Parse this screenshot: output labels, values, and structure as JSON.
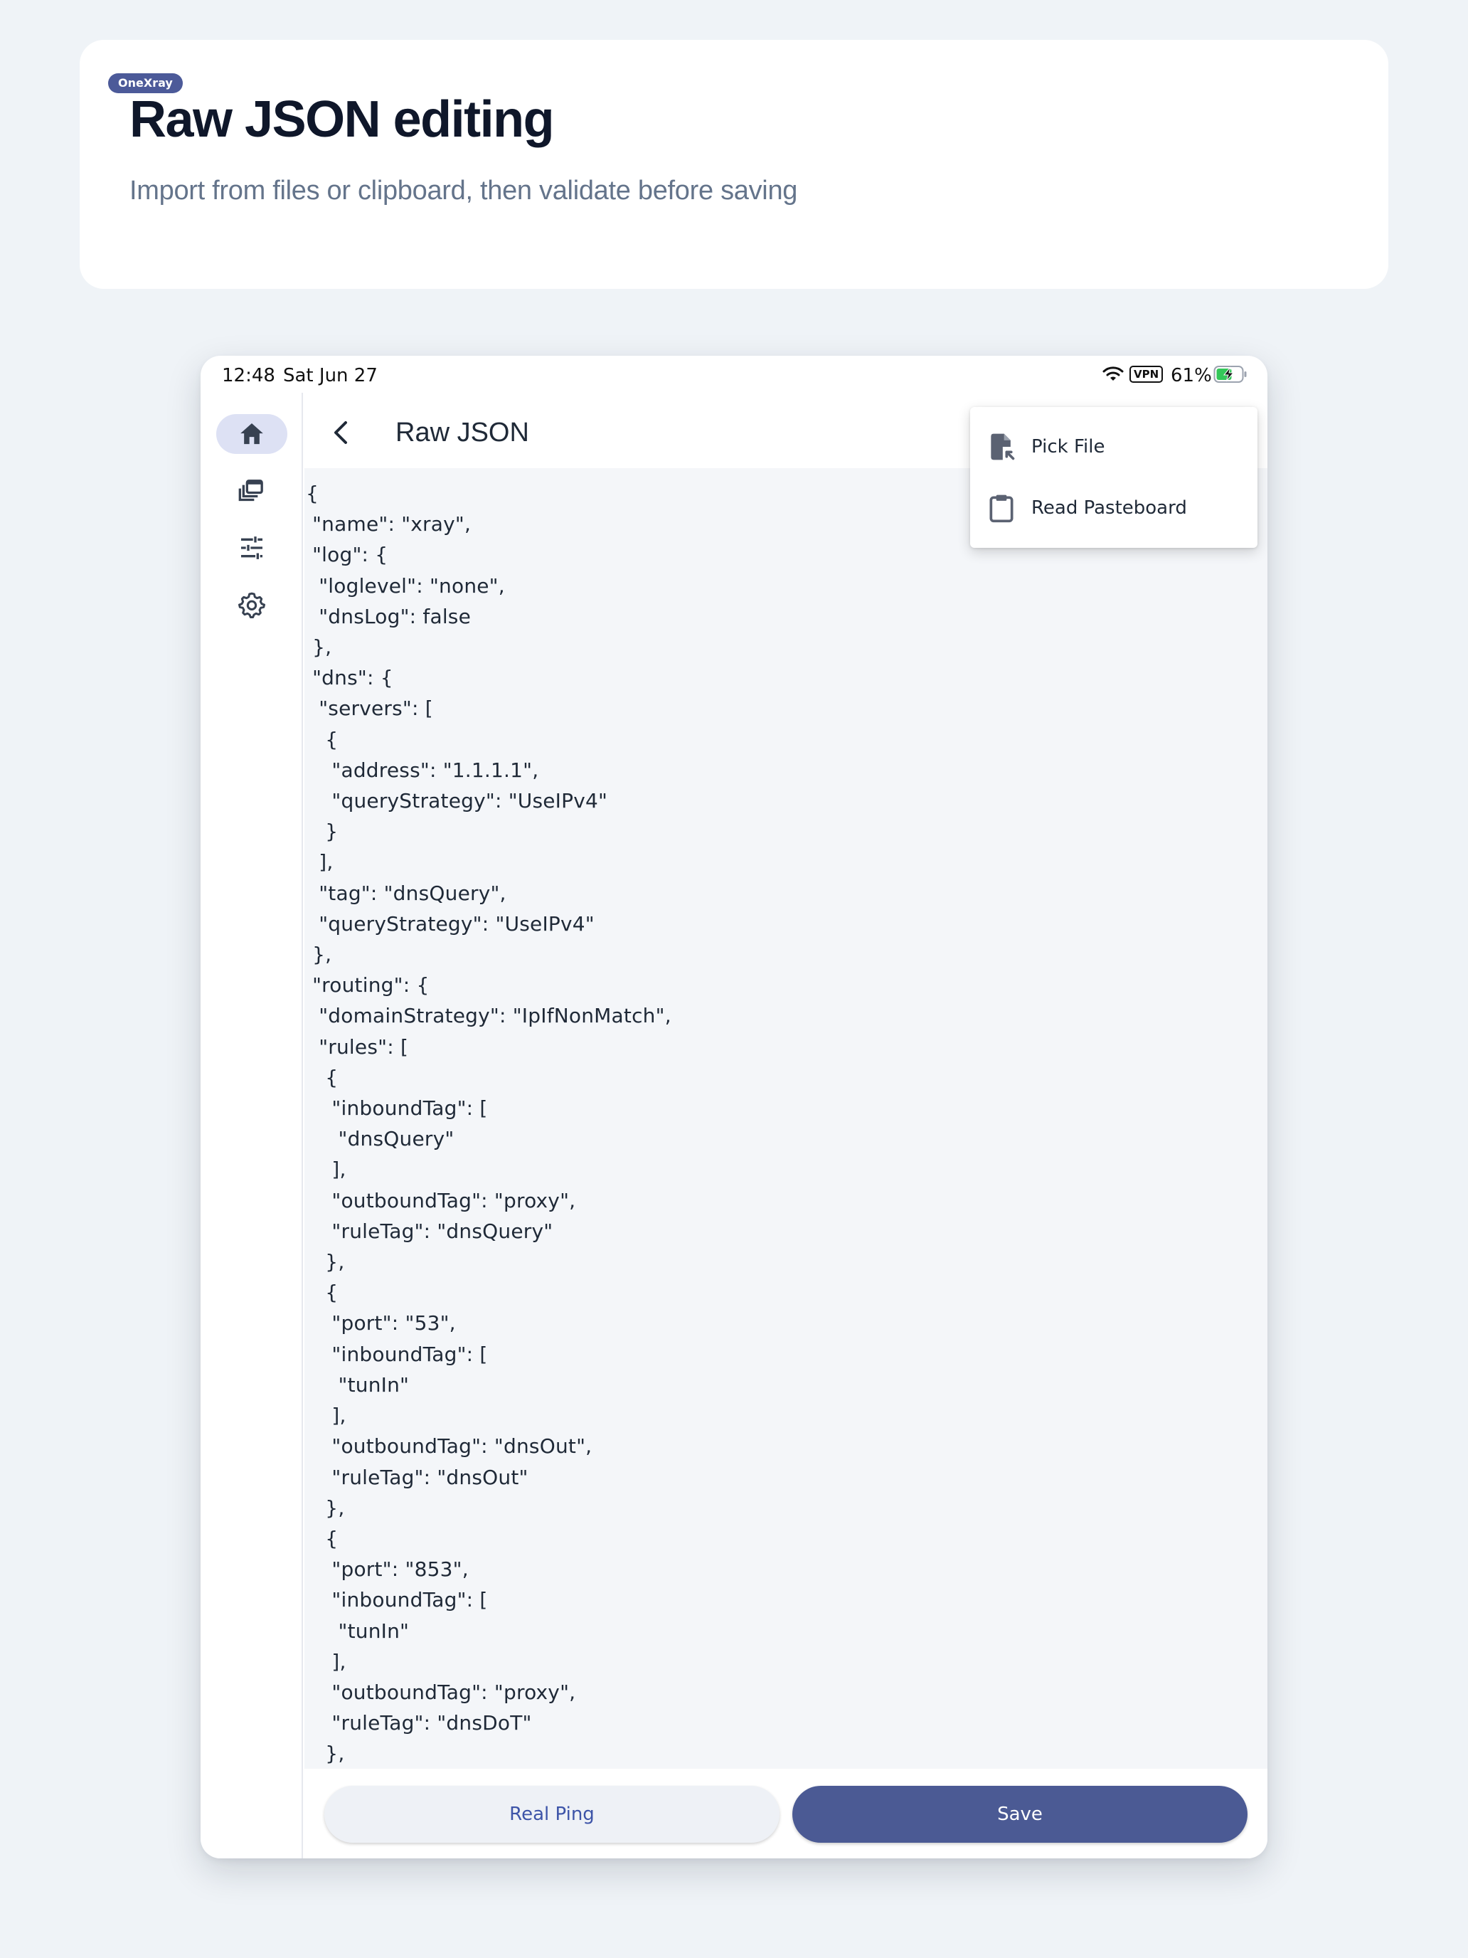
{
  "header": {
    "badge": "OneXray",
    "title": "Raw JSON editing",
    "subtitle": "Import from files or clipboard, then validate before saving"
  },
  "status_bar": {
    "time": "12:48",
    "date": "Sat Jun 27",
    "vpn": "VPN",
    "battery": "61%"
  },
  "nav_rail": {
    "items": [
      {
        "icon": "home-icon",
        "active": true
      },
      {
        "icon": "layers-icon",
        "active": false
      },
      {
        "icon": "sliders-icon",
        "active": false
      },
      {
        "icon": "gear-icon",
        "active": false
      }
    ]
  },
  "app_bar": {
    "title": "Raw JSON"
  },
  "editor": {
    "content": "{\n \"name\": \"xray\",\n \"log\": {\n  \"loglevel\": \"none\",\n  \"dnsLog\": false\n },\n \"dns\": {\n  \"servers\": [\n   {\n    \"address\": \"1.1.1.1\",\n    \"queryStrategy\": \"UseIPv4\"\n   }\n  ],\n  \"tag\": \"dnsQuery\",\n  \"queryStrategy\": \"UseIPv4\"\n },\n \"routing\": {\n  \"domainStrategy\": \"IpIfNonMatch\",\n  \"rules\": [\n   {\n    \"inboundTag\": [\n     \"dnsQuery\"\n    ],\n    \"outboundTag\": \"proxy\",\n    \"ruleTag\": \"dnsQuery\"\n   },\n   {\n    \"port\": \"53\",\n    \"inboundTag\": [\n     \"tunIn\"\n    ],\n    \"outboundTag\": \"dnsOut\",\n    \"ruleTag\": \"dnsOut\"\n   },\n   {\n    \"port\": \"853\",\n    \"inboundTag\": [\n     \"tunIn\"\n    ],\n    \"outboundTag\": \"proxy\",\n    \"ruleTag\": \"dnsDoT\"\n   },"
  },
  "menu": {
    "items": [
      {
        "label": "Pick File",
        "icon": "file-import-icon"
      },
      {
        "label": "Read Pasteboard",
        "icon": "clipboard-icon"
      }
    ]
  },
  "actions": {
    "ping_label": "Real Ping",
    "save_label": "Save"
  },
  "colors": {
    "accent": "#4b5a94",
    "badge": "#4c5a99",
    "link": "#3d54a8",
    "rail_active": "#dde1f4",
    "page_bg": "#eff3f7"
  }
}
